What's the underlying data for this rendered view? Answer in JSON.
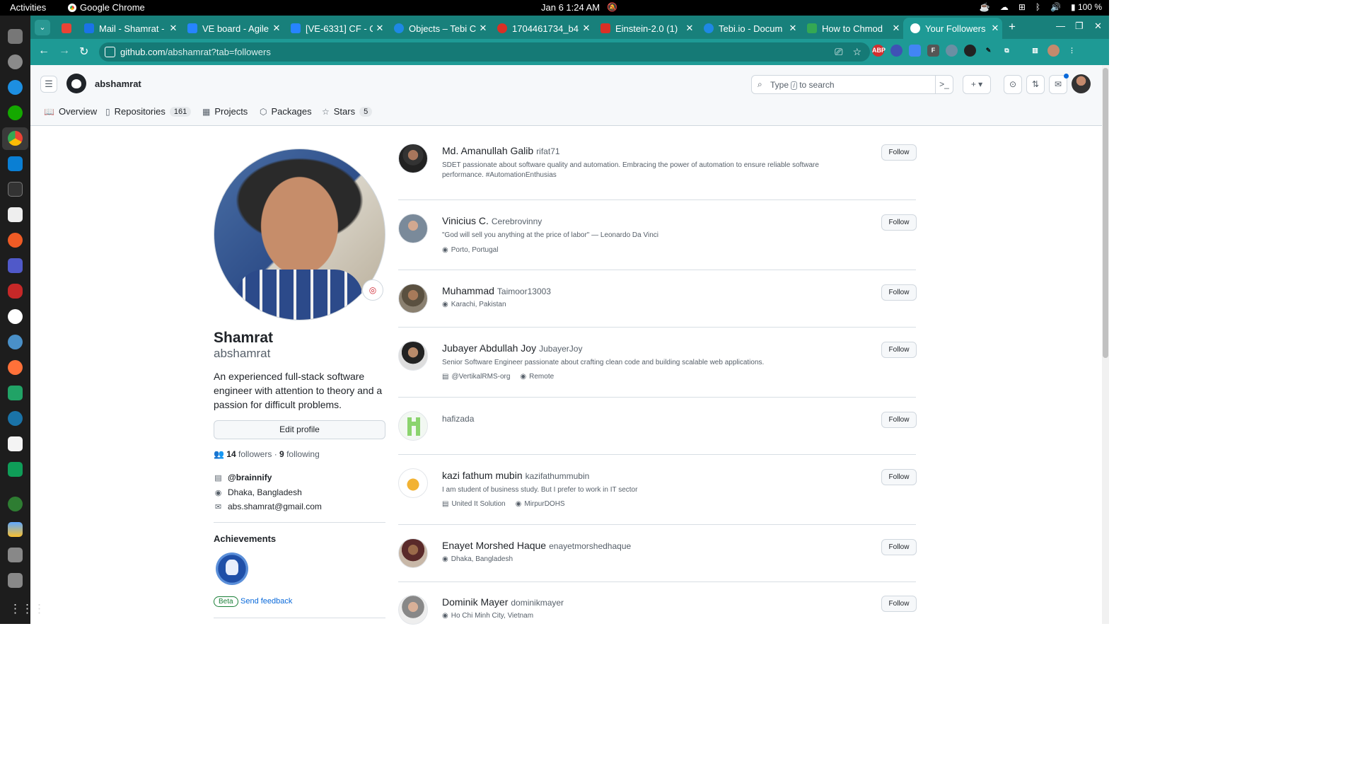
{
  "system": {
    "activities": "Activities",
    "app_name": "Google Chrome",
    "clock": "Jan 6  1:24 AM",
    "battery": "100 %"
  },
  "browser": {
    "tabs": [
      {
        "title": "Mail - Shamrat -",
        "color": "#1a73e8"
      },
      {
        "title": "VE board - Agile",
        "color": "#2684ff"
      },
      {
        "title": "[VE-6331] CF - C",
        "color": "#2684ff"
      },
      {
        "title": "Objects – Tebi C",
        "color": "#1e88e5"
      },
      {
        "title": "1704461734_b4",
        "color": "#d93025"
      },
      {
        "title": "Einstein-2.0 (1)",
        "color": "#d93025"
      },
      {
        "title": "Tebi.io - Docum",
        "color": "#1e88e5"
      },
      {
        "title": "How to Chmod",
        "color": "#34a853"
      },
      {
        "title": "Your Followers",
        "color": "#ffffff"
      }
    ],
    "url_host": "github.com",
    "url_path": "/abshamrat?tab=followers"
  },
  "github": {
    "header_user": "abshamrat",
    "search_placeholder_pre": "Type",
    "search_slash": "/",
    "search_placeholder_post": "to search",
    "nav": {
      "overview": "Overview",
      "repositories": "Repositories",
      "repositories_count": "161",
      "projects": "Projects",
      "packages": "Packages",
      "stars": "Stars",
      "stars_count": "5"
    }
  },
  "profile": {
    "display_name": "Shamrat",
    "login": "abshamrat",
    "bio": "An experienced full-stack software engineer with attention to theory and a passion for difficult problems.",
    "edit_button": "Edit profile",
    "followers_count": "14",
    "followers_label": "followers",
    "following_count": "9",
    "following_label": "following",
    "company": "@brainnify",
    "location": "Dhaka, Bangladesh",
    "email": "abs.shamrat@gmail.com",
    "achievements_title": "Achievements",
    "beta_label": "Beta",
    "feedback_label": "Send feedback"
  },
  "followers": [
    {
      "name": "Md. Amanullah Galib",
      "login": "rifat71",
      "bio": "SDET passionate about software quality and automation. Embracing the power of automation to ensure reliable software performance. #AutomationEnthusias",
      "company": "",
      "location": "",
      "follow": "Follow"
    },
    {
      "name": "Vinicius C.",
      "login": "Cerebrovinny",
      "bio": "\"God will sell you anything at the price of labor\" — Leonardo Da Vinci",
      "company": "",
      "location": "Porto, Portugal",
      "follow": "Follow"
    },
    {
      "name": "Muhammad",
      "login": "Taimoor13003",
      "bio": "",
      "company": "",
      "location": "Karachi, Pakistan",
      "follow": "Follow"
    },
    {
      "name": "Jubayer Abdullah Joy",
      "login": "JubayerJoy",
      "bio": "Senior Software Engineer passionate about crafting clean code and building scalable web applications.",
      "company": "@VertikalRMS-org",
      "location": "Remote",
      "follow": "Follow"
    },
    {
      "name": "",
      "login": "hafizada",
      "bio": "",
      "company": "",
      "location": "",
      "follow": "Follow"
    },
    {
      "name": "kazi fathum mubin",
      "login": "kazifathummubin",
      "bio": "I am student of business study. But I prefer to work in IT sector",
      "company": "United It Solution",
      "location": "MirpurDOHS",
      "follow": "Follow"
    },
    {
      "name": "Enayet Morshed Haque",
      "login": "enayetmorshedhaque",
      "bio": "",
      "company": "",
      "location": "Dhaka, Bangladesh",
      "follow": "Follow"
    },
    {
      "name": "Dominik Mayer",
      "login": "dominikmayer",
      "bio": "",
      "company": "",
      "location": "Ho Chi Minh City, Vietnam",
      "follow": "Follow"
    }
  ]
}
